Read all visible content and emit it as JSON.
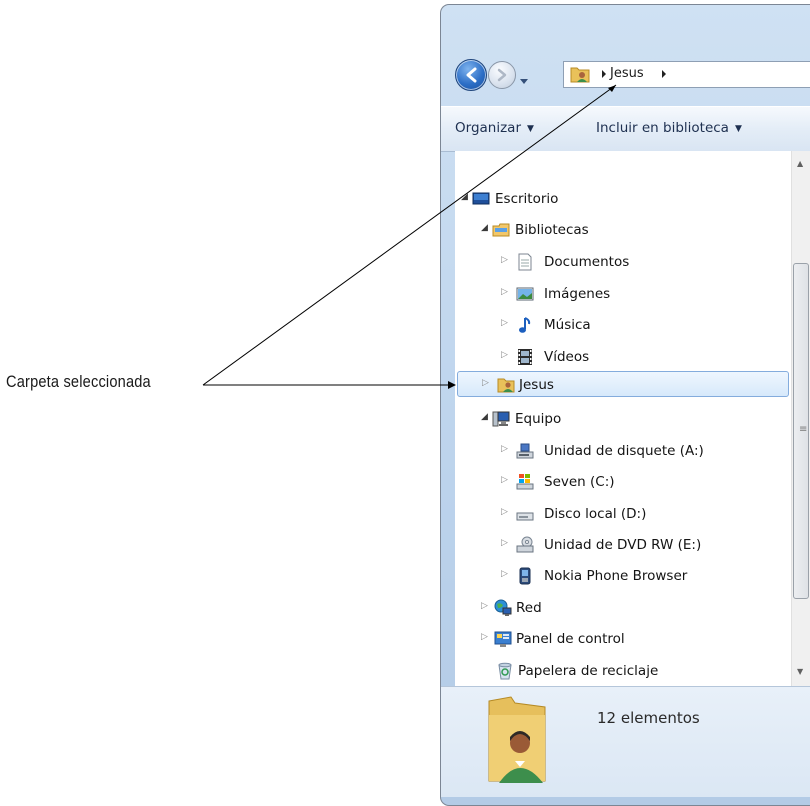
{
  "annotation": {
    "label": "Carpeta seleccionada"
  },
  "address_bar": {
    "folder": "Jesus"
  },
  "toolbar": {
    "organize": "Organizar",
    "include_in_library": "Incluir en biblioteca"
  },
  "tree": [
    {
      "label": "Escritorio",
      "icon": "desktop-icon",
      "expanded": true
    },
    {
      "label": "Bibliotecas",
      "icon": "libraries-icon",
      "expanded": true
    },
    {
      "label": "Documentos",
      "icon": "documents-icon",
      "expanded": false
    },
    {
      "label": "Imágenes",
      "icon": "pictures-icon",
      "expanded": false
    },
    {
      "label": "Música",
      "icon": "music-icon",
      "expanded": false
    },
    {
      "label": "Vídeos",
      "icon": "videos-icon",
      "expanded": false
    },
    {
      "label": "Jesus",
      "icon": "user-folder-icon",
      "expanded": false,
      "selected": true
    },
    {
      "label": "Equipo",
      "icon": "computer-icon",
      "expanded": true
    },
    {
      "label": "Unidad de disquete (A:)",
      "icon": "floppy-drive-icon",
      "expanded": false
    },
    {
      "label": "Seven (C:)",
      "icon": "system-drive-icon",
      "expanded": false
    },
    {
      "label": "Disco local (D:)",
      "icon": "local-disk-icon",
      "expanded": false
    },
    {
      "label": "Unidad de DVD RW (E:)",
      "icon": "dvd-drive-icon",
      "expanded": false
    },
    {
      "label": "Nokia Phone Browser",
      "icon": "phone-browser-icon",
      "expanded": false
    },
    {
      "label": "Red",
      "icon": "network-icon",
      "expanded": false
    },
    {
      "label": "Panel de control",
      "icon": "control-panel-icon",
      "expanded": false
    },
    {
      "label": "Papelera de reciclaje",
      "icon": "recycle-bin-icon"
    }
  ],
  "details_pane": {
    "item_count": "12 elementos"
  },
  "colors": {
    "selection_fill": "#d7e9fb",
    "selection_border": "#84acdd",
    "toolbar_text": "#1e3050"
  }
}
